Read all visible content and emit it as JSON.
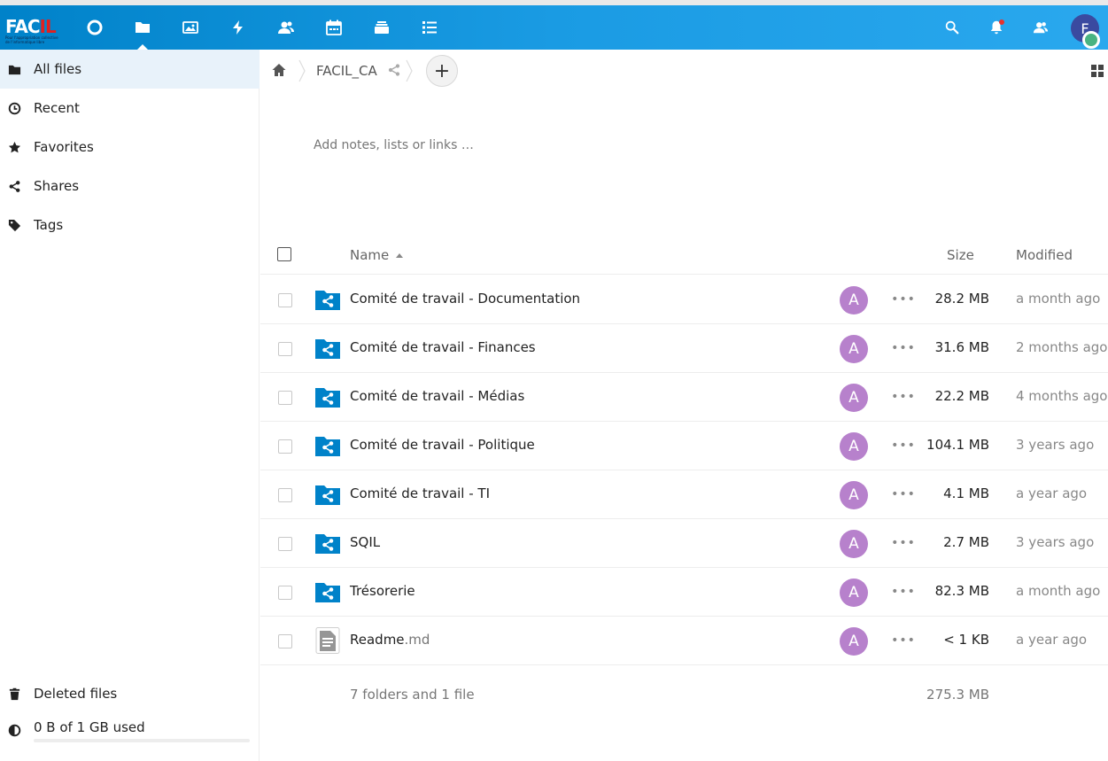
{
  "logo": {
    "text_main": "FAC",
    "text_accent": "IL",
    "tagline": "Pour l'appropriation collective de l'informatique libre"
  },
  "header": {
    "apps": [
      {
        "name": "dashboard-icon"
      },
      {
        "name": "files-icon"
      },
      {
        "name": "photos-icon"
      },
      {
        "name": "activity-icon"
      },
      {
        "name": "contacts-icon"
      },
      {
        "name": "calendar-icon"
      },
      {
        "name": "deck-icon"
      },
      {
        "name": "tasks-icon"
      }
    ],
    "user_initial": "F",
    "colors": {
      "accent": "#0082c9",
      "status": "#49b382",
      "notification": "#e9322d"
    }
  },
  "sidebar": {
    "items": [
      {
        "label": "All files",
        "icon": "folder-icon"
      },
      {
        "label": "Recent",
        "icon": "clock-icon"
      },
      {
        "label": "Favorites",
        "icon": "star-icon"
      },
      {
        "label": "Shares",
        "icon": "share-icon"
      },
      {
        "label": "Tags",
        "icon": "tag-icon"
      }
    ],
    "deleted_files": "Deleted files",
    "quota": {
      "label": "0 B of 1 GB used",
      "fraction": 0.0
    }
  },
  "breadcrumb": {
    "current": "FACIL_CA"
  },
  "new_button": "+",
  "notes_placeholder": "Add notes, lists or links …",
  "table": {
    "headers": {
      "name": "Name",
      "size": "Size",
      "modified": "Modified"
    },
    "rows": [
      {
        "name": "Comité de travail - Documentation",
        "ext": "",
        "type": "shared-folder",
        "sharer": "A",
        "size": "28.2 MB",
        "modified": "a month ago"
      },
      {
        "name": "Comité de travail - Finances",
        "ext": "",
        "type": "shared-folder",
        "sharer": "A",
        "size": "31.6 MB",
        "modified": "2 months ago"
      },
      {
        "name": "Comité de travail - Médias",
        "ext": "",
        "type": "shared-folder",
        "sharer": "A",
        "size": "22.2 MB",
        "modified": "4 months ago"
      },
      {
        "name": "Comité de travail - Politique",
        "ext": "",
        "type": "shared-folder",
        "sharer": "A",
        "size": "104.1 MB",
        "modified": "3 years ago"
      },
      {
        "name": "Comité de travail - TI",
        "ext": "",
        "type": "shared-folder",
        "sharer": "A",
        "size": "4.1 MB",
        "modified": "a year ago"
      },
      {
        "name": "SQIL",
        "ext": "",
        "type": "shared-folder",
        "sharer": "A",
        "size": "2.7 MB",
        "modified": "3 years ago"
      },
      {
        "name": "Trésorerie",
        "ext": "",
        "type": "shared-folder",
        "sharer": "A",
        "size": "82.3 MB",
        "modified": "a month ago"
      },
      {
        "name": "Readme",
        "ext": ".md",
        "type": "text-file",
        "sharer": "A",
        "size": "< 1 KB",
        "modified": "a year ago"
      }
    ],
    "summary": {
      "count": "7 folders and 1 file",
      "total": "275.3 MB"
    }
  }
}
